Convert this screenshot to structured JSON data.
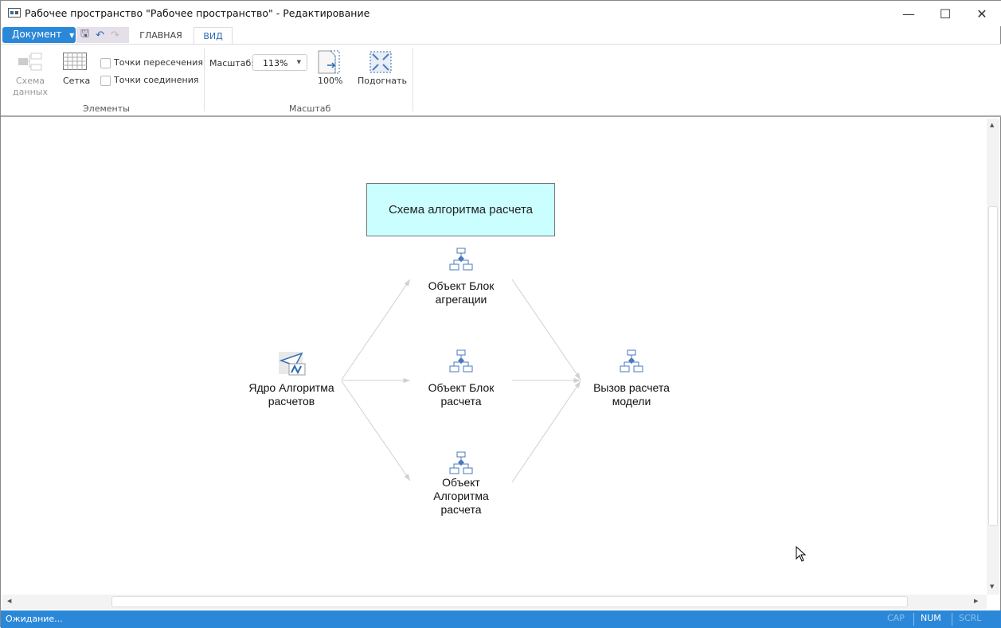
{
  "window": {
    "title": "Рабочее пространство \"Рабочее пространство\" - Редактирование",
    "minimize": "—",
    "maximize": "☐",
    "close": "✕"
  },
  "ribbon": {
    "document_label": "Документ",
    "tabs": [
      "ГЛАВНАЯ",
      "ВИД"
    ],
    "elements_group": {
      "label": "Элементы",
      "data_schema_line1": "Схема",
      "data_schema_line2": "данных",
      "grid": "Сетка",
      "intersection_points": "Точки пересечения",
      "connection_points": "Точки соединения"
    },
    "scale_group": {
      "label": "Масштаб",
      "scale_label": "Масштаб:",
      "scale_value": "113%",
      "actual_size": "100%",
      "fit": "Подогнать"
    }
  },
  "diagram": {
    "header": "Схема алгоритма расчета",
    "nodes": {
      "core": [
        "Ядро Алгоритма",
        "расчетов"
      ],
      "aggregation": [
        "Объект Блок",
        "агрегации"
      ],
      "calc_block": [
        "Объект Блок",
        "расчета"
      ],
      "algorithm": [
        "Объект",
        "Алгоритма",
        "расчета"
      ],
      "model_call": [
        "Вызов расчета",
        "модели"
      ]
    },
    "edge_color": "#d0d0d0"
  },
  "status": {
    "text": "Ожидание...",
    "cap": "CAP",
    "num": "NUM",
    "scrl": "SCRL"
  }
}
